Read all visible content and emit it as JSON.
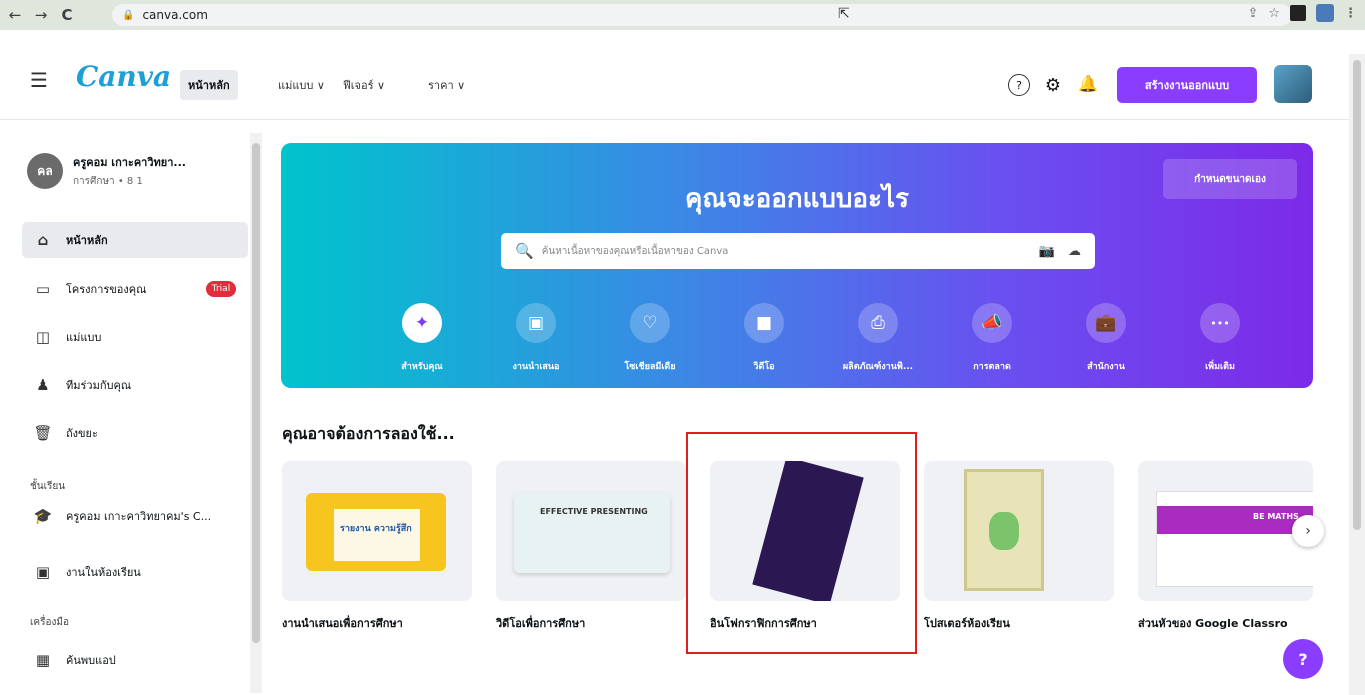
{
  "browser": {
    "url": "canva.com",
    "back_icon": "←",
    "forward_icon": "→",
    "reload_icon": "C",
    "share_icon": "⇪",
    "star_icon": "☆",
    "menu_icon": "⋮"
  },
  "topnav": {
    "logo": "Canva",
    "home": "หน้าหลัก",
    "links": [
      "แม่แบบ ∨",
      "ฟีเจอร์ ∨",
      "ราคา ∨"
    ],
    "create_button": "สร้างงานออกแบบ",
    "help_icon": "?",
    "settings_icon": "⚙",
    "bell_icon": "🔔"
  },
  "sidebar": {
    "profile_initials": "คล",
    "profile_name": "ครูคอม เกาะคาวิทยา...",
    "profile_sub": "การศึกษา • 8 1",
    "items": [
      {
        "label": "หน้าหลัก",
        "icon": "⌂"
      },
      {
        "label": "โครงการของคุณ",
        "icon": "▭"
      },
      {
        "label": "แม่แบบ",
        "icon": "◫"
      },
      {
        "label": "ทีมร่วมกับคุณ",
        "icon": "♟"
      },
      {
        "label": "ถังขยะ",
        "icon": "🗑"
      }
    ],
    "trial_badge": "Trial",
    "section_class": "ชั้นเรียน",
    "class_items": [
      {
        "label": "ครูคอม เกาะคาวิทยาคม's C...",
        "icon": "🎓"
      },
      {
        "label": "งานในห้องเรียน",
        "icon": "▣"
      }
    ],
    "section_tools": "เครื่องมือ",
    "tool_items": [
      {
        "label": "ค้นพบแอป",
        "icon": "▦"
      }
    ]
  },
  "hero": {
    "title": "คุณจะออกแบบอะไร",
    "custom_size_button": "กำหนดขนาดเอง",
    "search_placeholder": "ค้นหาเนื้อหาของคุณหรือเนื้อหาของ Canva",
    "categories": [
      {
        "label": "สำหรับคุณ",
        "icon": "✦"
      },
      {
        "label": "งานนำเสนอ",
        "icon": "▣"
      },
      {
        "label": "โซเชียลมีเดีย",
        "icon": "♡"
      },
      {
        "label": "วิดีโอ",
        "icon": "■"
      },
      {
        "label": "ผลิตภัณฑ์งานพิ...",
        "icon": "⎙"
      },
      {
        "label": "การตลาด",
        "icon": "📣"
      },
      {
        "label": "สำนักงาน",
        "icon": "💼"
      },
      {
        "label": "เพิ่มเติม",
        "icon": "•••"
      }
    ]
  },
  "suggestions": {
    "title": "คุณอาจต้องการลองใช้...",
    "cards": [
      {
        "label": "งานนำเสนอเพื่อการศึกษา",
        "thumb_text": "รายงาน ความรู้สึก"
      },
      {
        "label": "วิดีโอเพื่อการศึกษา",
        "thumb_text": "EFFECTIVE PRESENTING"
      },
      {
        "label": "อินโฟกราฟิกการศึกษา",
        "thumb_text": ""
      },
      {
        "label": "โปสเตอร์ห้องเรียน",
        "thumb_text": ""
      },
      {
        "label": "ส่วนหัวของ Google Classro",
        "thumb_text": "BE MATHS"
      }
    ],
    "next_icon": "›",
    "help_icon": "?"
  }
}
